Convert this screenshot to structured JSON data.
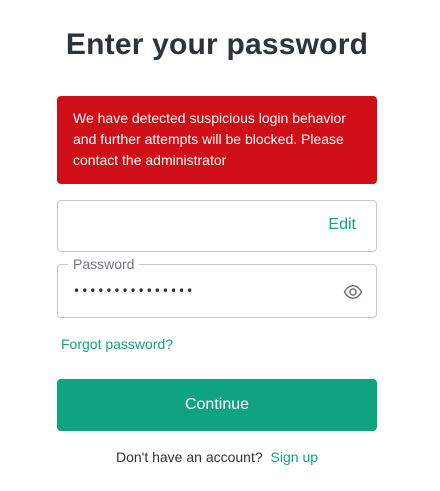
{
  "page": {
    "title": "Enter your password"
  },
  "alert": {
    "message": "We have detected suspicious login behavior and further attempts will be blocked. Please contact the administrator",
    "color": "#d00e17"
  },
  "email_field": {
    "value": "",
    "edit_label": "Edit"
  },
  "password_field": {
    "label": "Password",
    "value": "•••••••••••••••",
    "toggle_icon": "eye-icon"
  },
  "links": {
    "forgot_password": "Forgot password?"
  },
  "continue_button": {
    "label": "Continue",
    "color": "#10a37f"
  },
  "signup": {
    "prompt": "Don't have an account?",
    "link_label": "Sign up"
  }
}
